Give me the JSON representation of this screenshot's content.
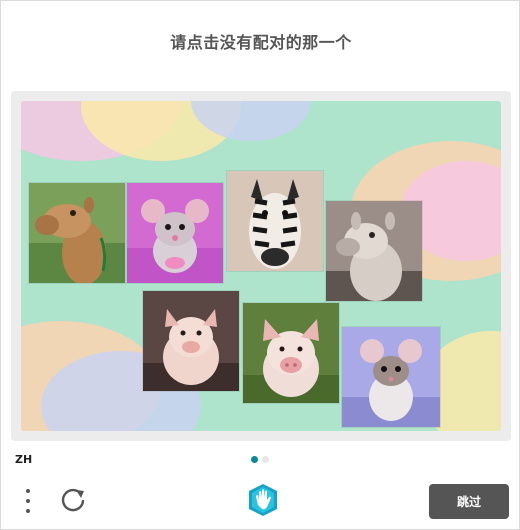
{
  "challenge": {
    "prompt": "请点击没有配对的那一个"
  },
  "tiles": [
    {
      "animal": "camel",
      "name": "tile-camel"
    },
    {
      "animal": "mouse",
      "name": "tile-mouse-pink"
    },
    {
      "animal": "zebra",
      "name": "tile-zebra"
    },
    {
      "animal": "camel",
      "name": "tile-camel-sepia"
    },
    {
      "animal": "pig",
      "name": "tile-pig-1"
    },
    {
      "animal": "pig",
      "name": "tile-pig-2"
    },
    {
      "animal": "mouse",
      "name": "tile-mouse-white"
    }
  ],
  "footer": {
    "language": "ZH",
    "page_count": 2,
    "active_page": 1,
    "skip_label": "跳过"
  },
  "icons": {
    "menu": "more-vertical-icon",
    "refresh": "refresh-icon",
    "logo": "hand-logo-icon"
  },
  "colors": {
    "accent": "#0a8a96",
    "skip_button": "#555555",
    "frame_bg": "#ececec",
    "canvas_bg": "#aee3cc"
  }
}
